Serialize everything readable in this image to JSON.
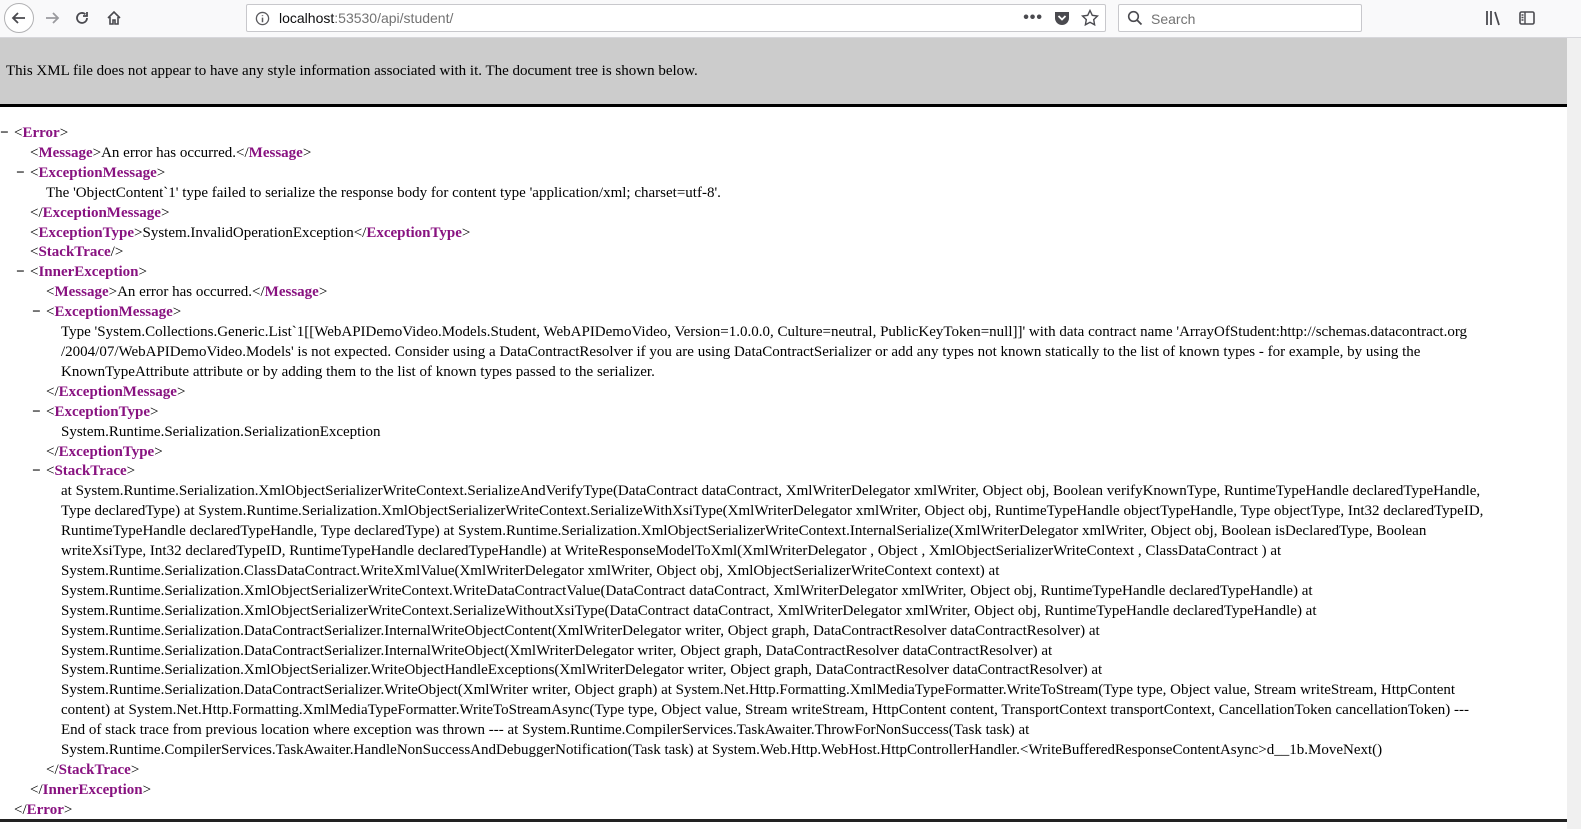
{
  "browser": {
    "url": "localhost:53530/api/student/",
    "url_host": "localhost",
    "url_rest": ":53530/api/student/",
    "search_placeholder": "Search"
  },
  "notice": "This XML file does not appear to have any style information associated with it. The document tree is shown below.",
  "fold_symbol": "−",
  "tags": {
    "error": "Error",
    "message": "Message",
    "exception_message": "ExceptionMessage",
    "exception_type": "ExceptionType",
    "stack_trace": "StackTrace",
    "inner_exception": "InnerException"
  },
  "xml": {
    "message": "An error has occurred.",
    "exception_message": "The 'ObjectContent`1' type failed to serialize the response body for content type 'application/xml; charset=utf-8'.",
    "exception_type": "System.InvalidOperationException",
    "inner": {
      "message": "An error has occurred.",
      "exception_message_lines": [
        "Type 'System.Collections.Generic.List`1[[WebAPIDemoVideo.Models.Student, WebAPIDemoVideo, Version=1.0.0.0, Culture=neutral, PublicKeyToken=null]]' with data contract name 'ArrayOfStudent:http://schemas.datacontract.org",
        "/2004/07/WebAPIDemoVideo.Models' is not expected. Consider using a DataContractResolver if you are using DataContractSerializer or add any types not known statically to the list of known types - for example, by using the",
        "KnownTypeAttribute attribute or by adding them to the list of known types passed to the serializer."
      ],
      "exception_type": "System.Runtime.Serialization.SerializationException",
      "stack_trace_lines": [
        "at System.Runtime.Serialization.XmlObjectSerializerWriteContext.SerializeAndVerifyType(DataContract dataContract, XmlWriterDelegator xmlWriter, Object obj, Boolean verifyKnownType, RuntimeTypeHandle declaredTypeHandle,",
        "Type declaredType) at System.Runtime.Serialization.XmlObjectSerializerWriteContext.SerializeWithXsiType(XmlWriterDelegator xmlWriter, Object obj, RuntimeTypeHandle objectTypeHandle, Type objectType, Int32 declaredTypeID,",
        "RuntimeTypeHandle declaredTypeHandle, Type declaredType) at System.Runtime.Serialization.XmlObjectSerializerWriteContext.InternalSerialize(XmlWriterDelegator xmlWriter, Object obj, Boolean isDeclaredType, Boolean",
        "writeXsiType, Int32 declaredTypeID, RuntimeTypeHandle declaredTypeHandle) at WriteResponseModelToXml(XmlWriterDelegator , Object , XmlObjectSerializerWriteContext , ClassDataContract ) at",
        "System.Runtime.Serialization.ClassDataContract.WriteXmlValue(XmlWriterDelegator xmlWriter, Object obj, XmlObjectSerializerWriteContext context) at",
        "System.Runtime.Serialization.XmlObjectSerializerWriteContext.WriteDataContractValue(DataContract dataContract, XmlWriterDelegator xmlWriter, Object obj, RuntimeTypeHandle declaredTypeHandle) at",
        "System.Runtime.Serialization.XmlObjectSerializerWriteContext.SerializeWithoutXsiType(DataContract dataContract, XmlWriterDelegator xmlWriter, Object obj, RuntimeTypeHandle declaredTypeHandle) at",
        "System.Runtime.Serialization.DataContractSerializer.InternalWriteObjectContent(XmlWriterDelegator writer, Object graph, DataContractResolver dataContractResolver) at",
        "System.Runtime.Serialization.DataContractSerializer.InternalWriteObject(XmlWriterDelegator writer, Object graph, DataContractResolver dataContractResolver) at",
        "System.Runtime.Serialization.XmlObjectSerializer.WriteObjectHandleExceptions(XmlWriterDelegator writer, Object graph, DataContractResolver dataContractResolver) at",
        "System.Runtime.Serialization.DataContractSerializer.WriteObject(XmlWriter writer, Object graph) at System.Net.Http.Formatting.XmlMediaTypeFormatter.WriteToStream(Type type, Object value, Stream writeStream, HttpContent",
        "content) at System.Net.Http.Formatting.XmlMediaTypeFormatter.WriteToStreamAsync(Type type, Object value, Stream writeStream, HttpContent content, TransportContext transportContext, CancellationToken cancellationToken) ---",
        "End of stack trace from previous location where exception was thrown --- at System.Runtime.CompilerServices.TaskAwaiter.ThrowForNonSuccess(Task task) at",
        "System.Runtime.CompilerServices.TaskAwaiter.HandleNonSuccessAndDebuggerNotification(Task task) at System.Web.Http.WebHost.HttpControllerHandler.<WriteBufferedResponseContentAsync>d__1b.MoveNext()"
      ]
    }
  }
}
